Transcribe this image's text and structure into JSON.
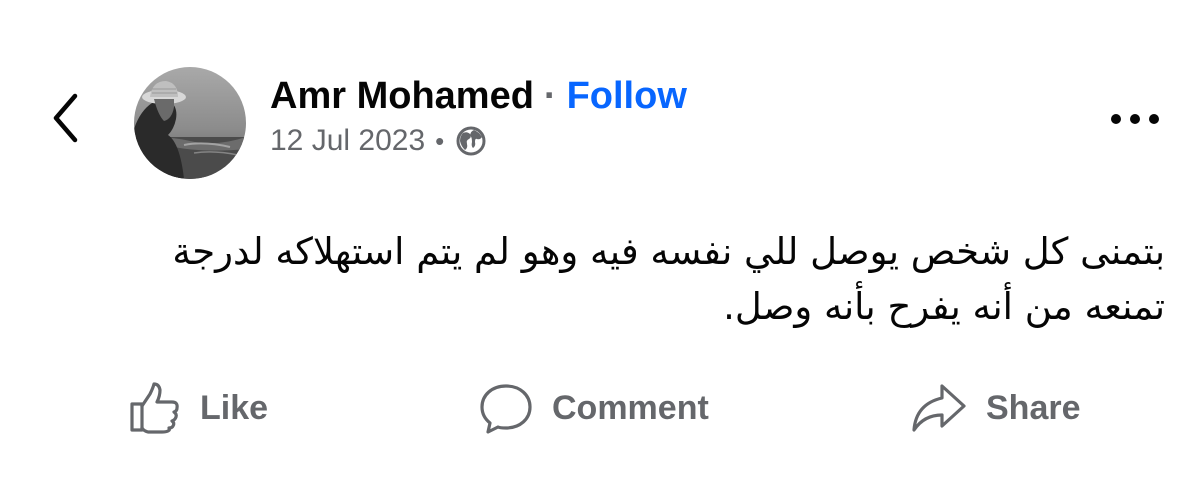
{
  "post": {
    "author_name": "Amr Mohamed",
    "separator": "·",
    "follow_label": "Follow",
    "date": "12 Jul 2023",
    "meta_separator": "•",
    "audience_icon": "globe-icon",
    "text": "بتمنى كل شخص يوصل للي نفسه فيه وهو لم يتم استهلاكه لدرجة تمنعه من أنه يفرح بأنه وصل."
  },
  "actions": {
    "like_label": "Like",
    "comment_label": "Comment",
    "share_label": "Share"
  },
  "icons": {
    "back": "chevron-left-icon",
    "more": "more-dots-icon",
    "like": "thumbs-up-icon",
    "comment": "comment-bubble-icon",
    "share": "share-arrow-icon"
  },
  "colors": {
    "follow": "#0866ff",
    "secondary_text": "#65676b",
    "primary_text": "#050505",
    "background": "#ffffff"
  }
}
